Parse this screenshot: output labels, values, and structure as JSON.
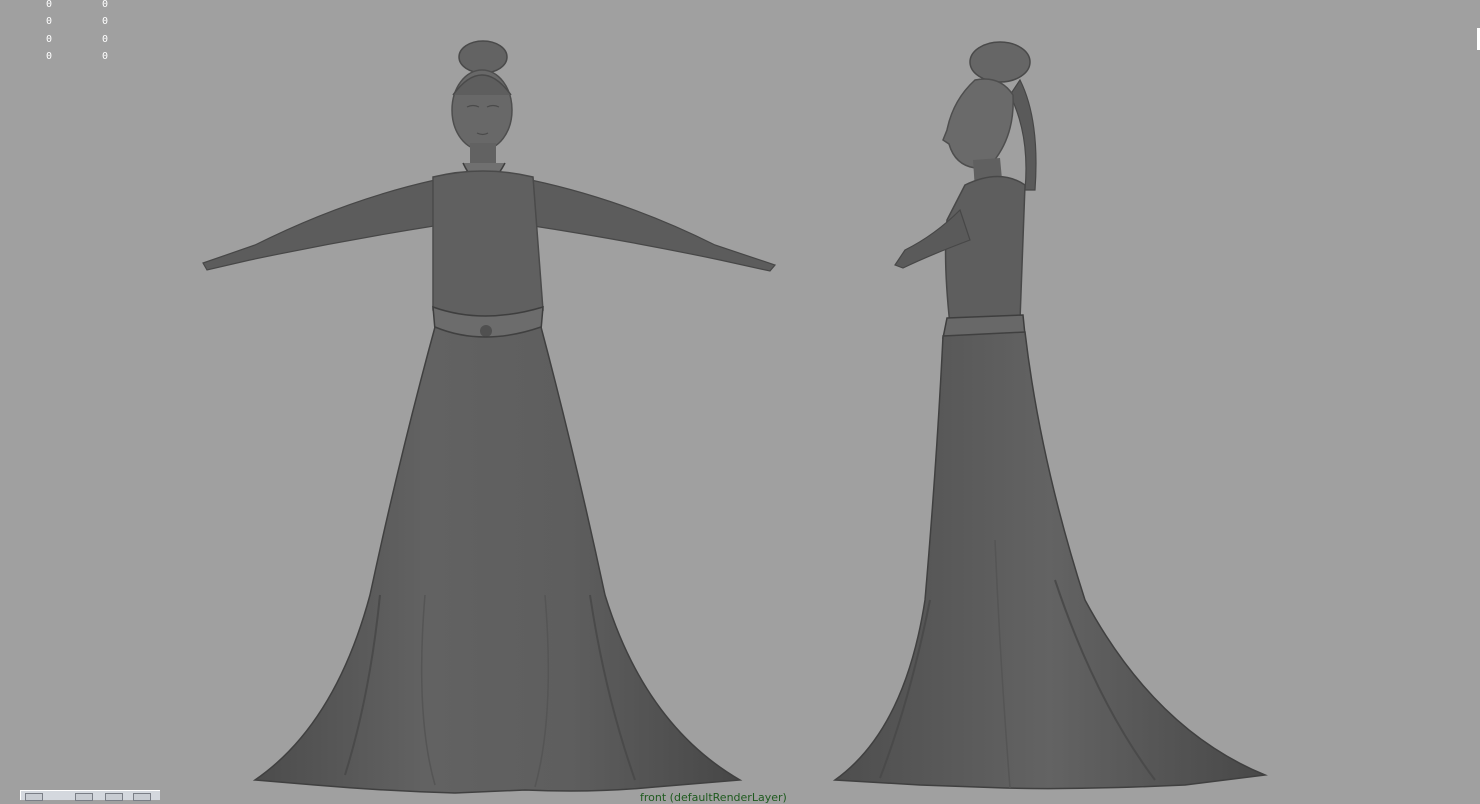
{
  "hud": {
    "col1": [
      "0",
      "0",
      "0",
      "0"
    ],
    "col2": [
      "0",
      "0",
      "0",
      "0"
    ]
  },
  "viewport": {
    "camera_label": "front (defaultRenderLayer)",
    "background_color": "#a0a0a0"
  },
  "models": {
    "front_view": "figure-front-view",
    "side_view": "figure-side-view"
  },
  "colors": {
    "mesh": "#5a5a5a",
    "mesh_shadow": "#454545",
    "mesh_highlight": "#6e6e6e",
    "label": "#1e5a1e"
  }
}
